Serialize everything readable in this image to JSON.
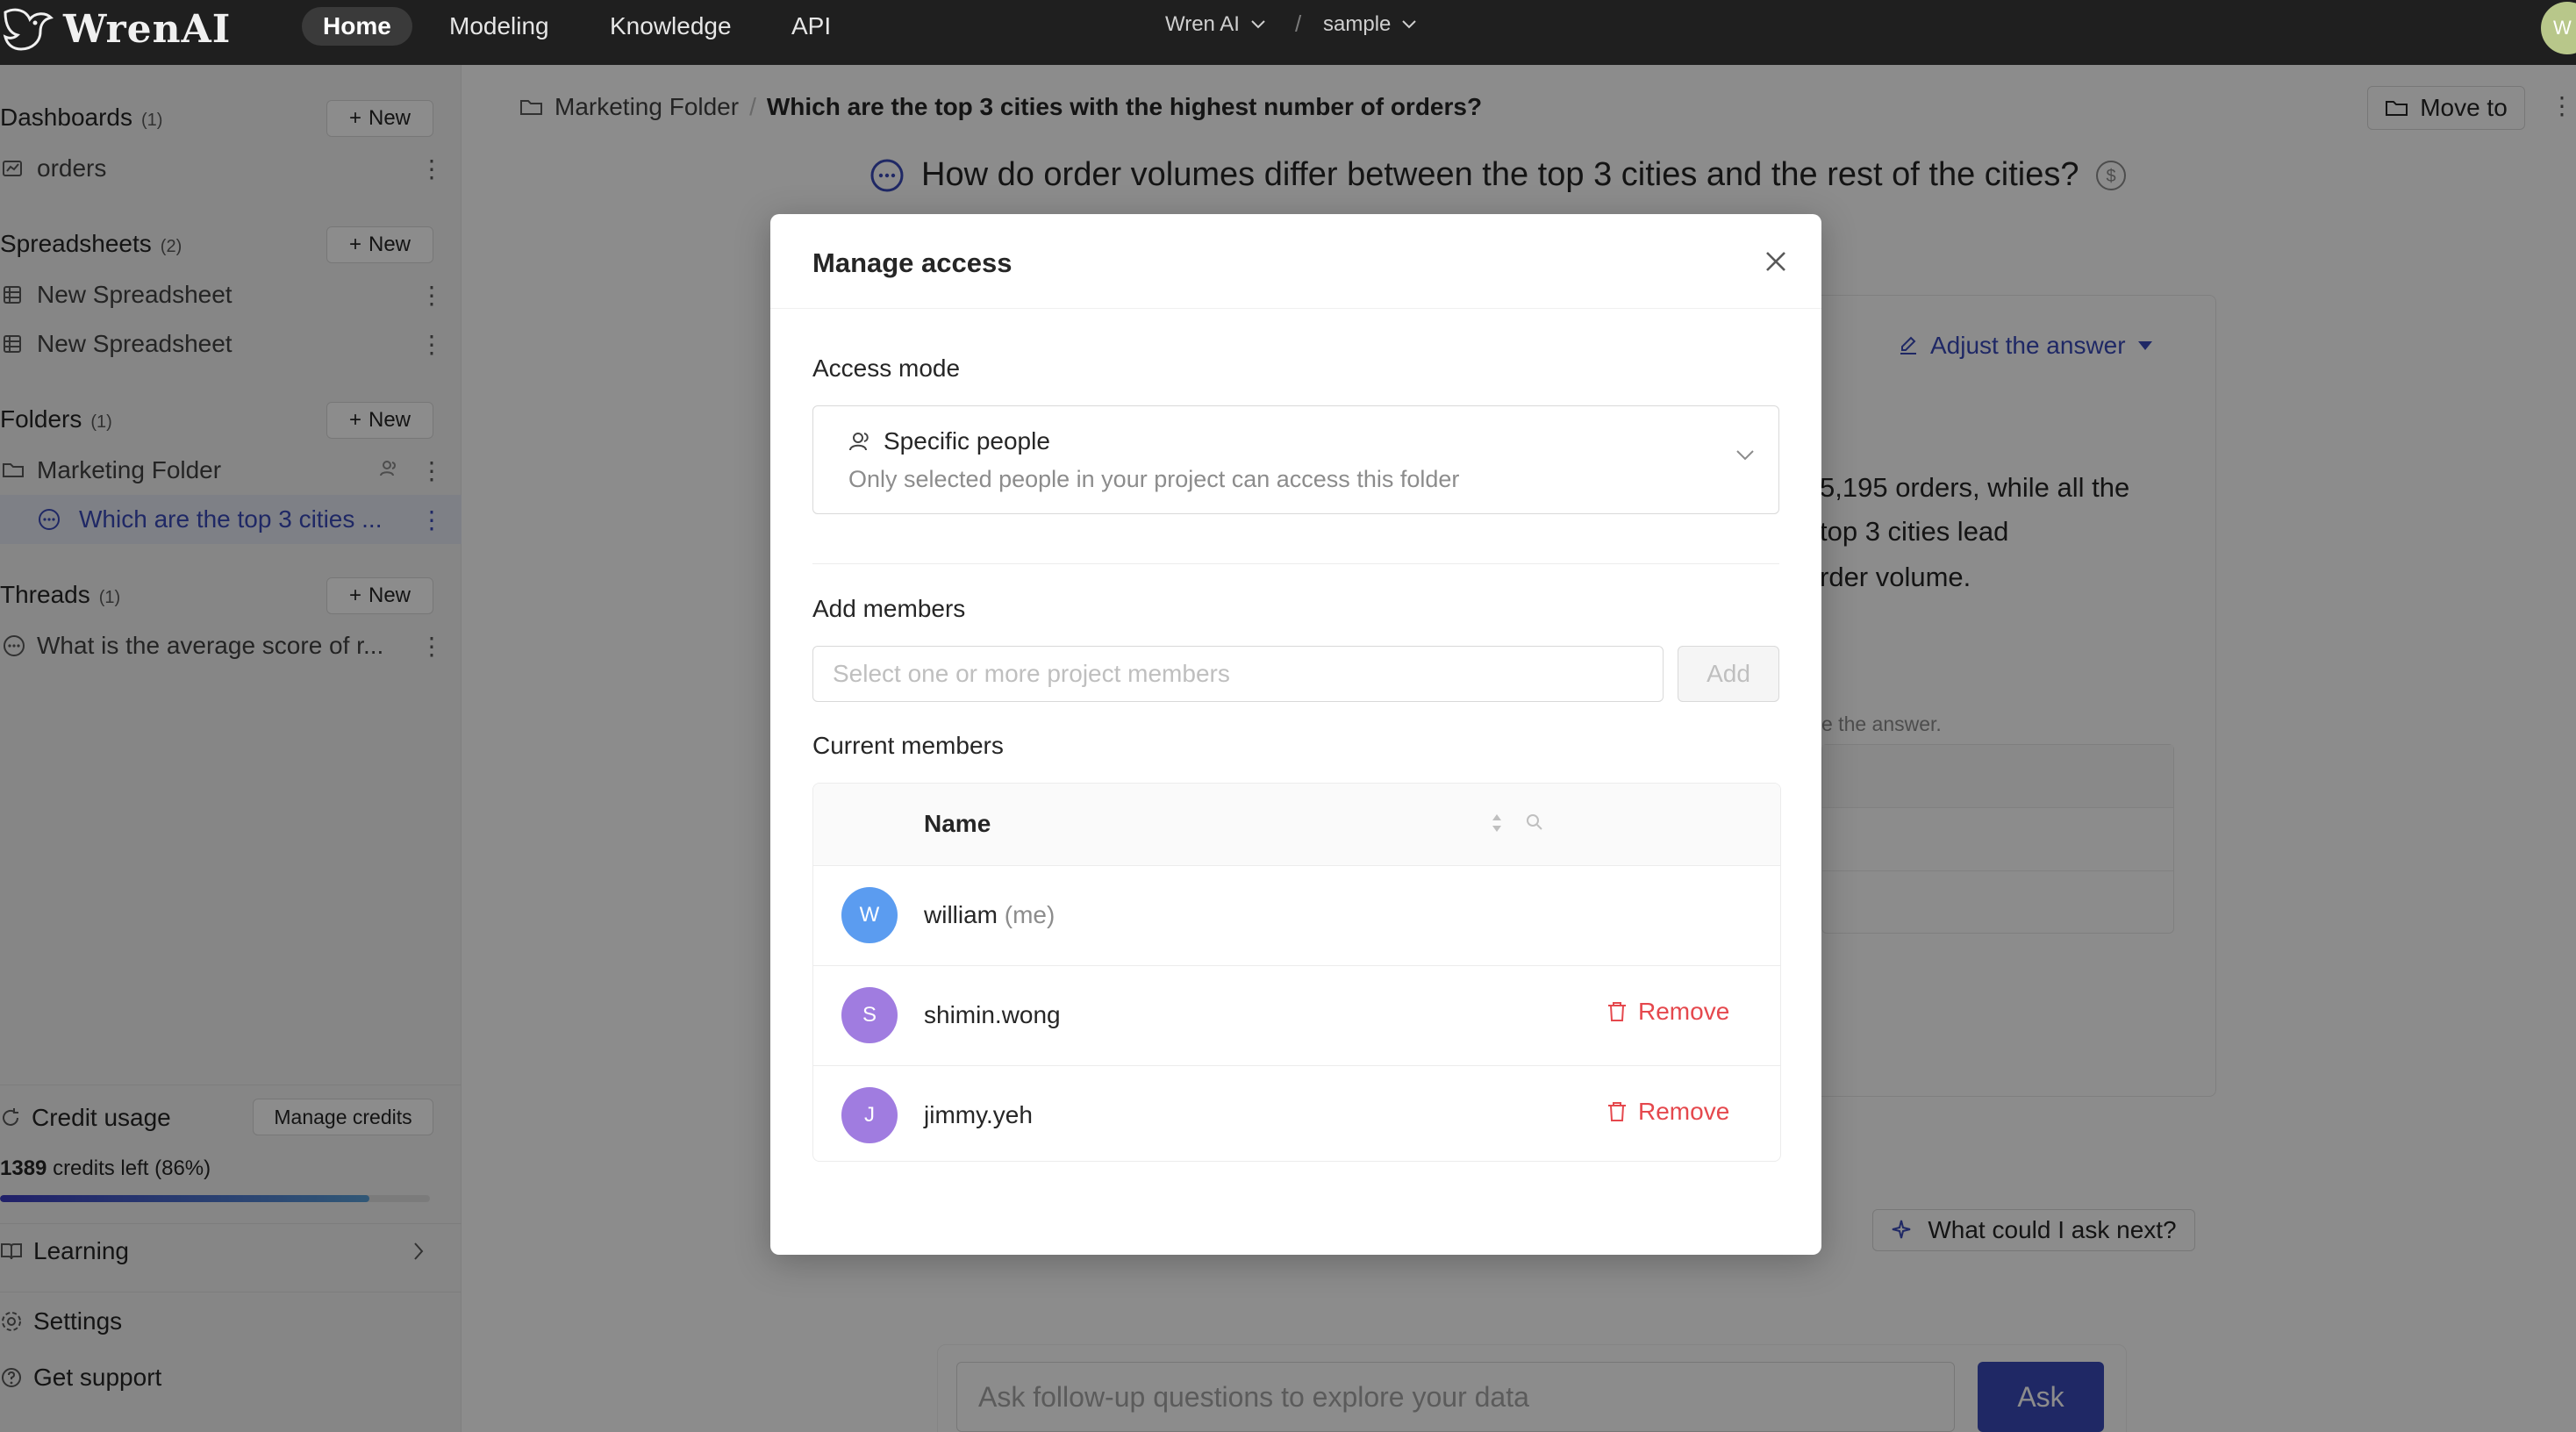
{
  "topbar": {
    "logo": "WrenAI",
    "nav": [
      "Home",
      "Modeling",
      "Knowledge",
      "API"
    ],
    "workspace": "Wren AI",
    "project": "sample",
    "avatar_initial": "W"
  },
  "sidebar": {
    "new_label": "New",
    "dashboards": {
      "title": "Dashboards",
      "count": "(1)",
      "items": [
        "orders"
      ]
    },
    "spreadsheets": {
      "title": "Spreadsheets",
      "count": "(2)",
      "items": [
        "New Spreadsheet",
        "New Spreadsheet"
      ]
    },
    "folders": {
      "title": "Folders",
      "count": "(1)",
      "folder": "Marketing Folder",
      "thread": "Which are the top 3 cities ..."
    },
    "threads": {
      "title": "Threads",
      "count": "(1)",
      "items": [
        "What is the average score of r..."
      ]
    },
    "credit": {
      "label": "Credit usage",
      "manage": "Manage credits",
      "amount": "1389",
      "left_text": "credits left (86%)",
      "percent": 86
    },
    "learning": "Learning",
    "settings": "Settings",
    "support": "Get support"
  },
  "main": {
    "breadcrumb_folder": "Marketing Folder",
    "breadcrumb_sep": "/",
    "breadcrumb_current": "Which are the top 3 cities with the highest number of orders?",
    "move_to": "Move to",
    "question": "How do order volumes differ between the top 3 cities and the rest of the cities?",
    "adjust": "Adjust the answer",
    "answer_lines": [
      "5,195 orders, while all the",
      "top 3 cities lead",
      "rder volume."
    ],
    "answer_note": "e the answer.",
    "next": "What could I ask next?",
    "followup_placeholder": "Ask follow-up questions to explore your data",
    "ask": "Ask"
  },
  "modal": {
    "title": "Manage access",
    "access_mode_label": "Access mode",
    "access_mode_value": "Specific people",
    "access_mode_desc": "Only selected people in your project can access this folder",
    "add_members_label": "Add members",
    "add_members_placeholder": "Select one or more project members",
    "add_button": "Add",
    "current_members_label": "Current members",
    "column_name": "Name",
    "remove_label": "Remove",
    "members": [
      {
        "initial": "W",
        "name": "william",
        "me": "(me)",
        "color": "#5b9cf0",
        "removable": false
      },
      {
        "initial": "S",
        "name": "shimin.wong",
        "me": "",
        "color": "#a07ce0",
        "removable": true
      },
      {
        "initial": "J",
        "name": "jimmy.yeh",
        "me": "",
        "color": "#a07ce0",
        "removable": true
      }
    ]
  },
  "colors": {
    "accent": "#3a4ab8",
    "danger": "#e5484d",
    "topbar": "#1f1f1f"
  }
}
